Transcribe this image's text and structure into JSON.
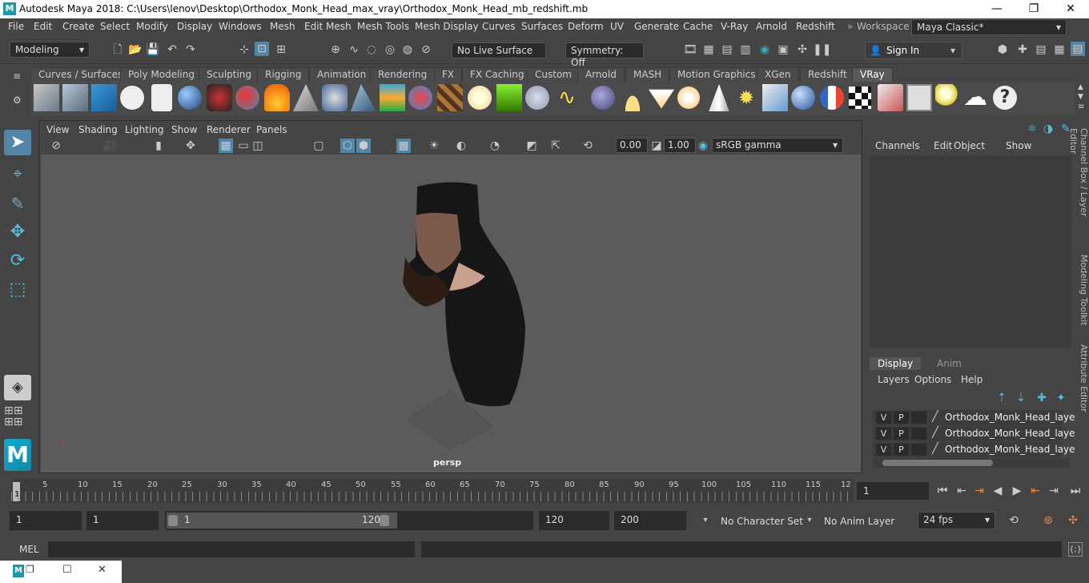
{
  "window": {
    "title": "Autodesk Maya 2018: C:\\Users\\lenov\\Desktop\\Orthodox_Monk_Head_max_vray\\Orthodox_Monk_Head_mb_redshift.mb",
    "minimize": "—",
    "maximize": "❐",
    "close": "✕"
  },
  "menubar": [
    "File",
    "Edit",
    "Create",
    "Select",
    "Modify",
    "Display",
    "Windows",
    "Mesh",
    "Edit Mesh",
    "Mesh Tools",
    "Mesh Display",
    "Curves",
    "Surfaces",
    "Deform",
    "UV",
    "Generate",
    "Cache",
    "V-Ray",
    "Arnold",
    "Redshift"
  ],
  "workspace": {
    "label": "Workspace :",
    "value": "Maya Classic*"
  },
  "status": {
    "mode": "Modeling",
    "live_surface": "No Live Surface",
    "symmetry": "Symmetry: Off",
    "sign_in": "Sign In"
  },
  "shelf_tabs": [
    "Curves / Surfaces",
    "Poly Modeling",
    "Sculpting",
    "Rigging",
    "Animation",
    "Rendering",
    "FX",
    "FX Caching",
    "Custom",
    "Arnold",
    "MASH",
    "Motion Graphics",
    "XGen",
    "Redshift",
    "VRay"
  ],
  "shelf_active": "VRay",
  "viewport": {
    "menu": [
      "View",
      "Shading",
      "Lighting",
      "Show",
      "Renderer",
      "Panels"
    ],
    "exposure": "0.00",
    "gamma": "1.00",
    "color_space": "sRGB gamma",
    "camera_label": "persp"
  },
  "channel_box": {
    "menu": [
      "Channels",
      "Edit",
      "Object",
      "Show"
    ]
  },
  "layer_editor": {
    "tabs": [
      "Display",
      "Anim"
    ],
    "menu": [
      "Layers",
      "Options",
      "Help"
    ],
    "layers": [
      {
        "v": "V",
        "p": "P",
        "name": "Orthodox_Monk_Head_laye"
      },
      {
        "v": "V",
        "p": "P",
        "name": "Orthodox_Monk_Head_laye"
      },
      {
        "v": "V",
        "p": "P",
        "name": "Orthodox_Monk_Head_laye"
      }
    ]
  },
  "side_tabs": [
    "Channel Box / Layer Editor",
    "Modeling Toolkit",
    "Attribute Editor"
  ],
  "timeline": {
    "ticks": [
      "1",
      "5",
      "10",
      "15",
      "20",
      "25",
      "30",
      "35",
      "40",
      "45",
      "50",
      "55",
      "60",
      "65",
      "70",
      "75",
      "80",
      "85",
      "90",
      "95",
      "100",
      "105",
      "110",
      "115",
      "12"
    ],
    "current_frame": "1"
  },
  "range": {
    "start": "1",
    "start_inner": "1",
    "slider_start": "1",
    "slider_end": "120",
    "end_inner": "120",
    "end": "200",
    "character_set": "No Character Set",
    "anim_layer": "No Anim Layer",
    "fps": "24 fps"
  },
  "cmdline": {
    "label": "MEL"
  },
  "colors": {
    "accent": "#5285a6",
    "panel": "#444444",
    "field": "#2b2b2b",
    "viewport_bg": "#5b5b5b"
  }
}
